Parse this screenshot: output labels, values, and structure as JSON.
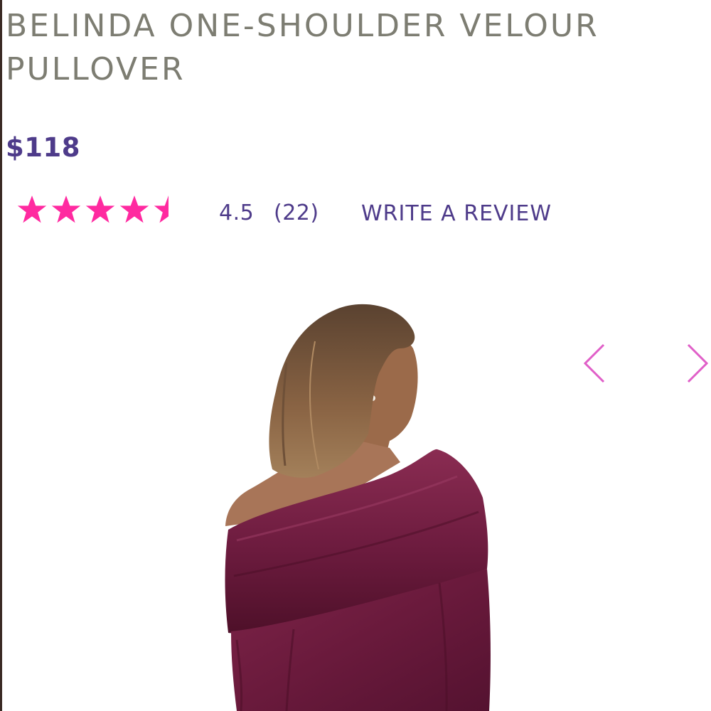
{
  "product": {
    "title": "BELINDA ONE-SHOULDER VELOUR PULLOVER",
    "price": "$118"
  },
  "rating": {
    "value": "4.5",
    "count": "(22)",
    "stars_filled": 4.5,
    "stars_total": 5,
    "star_color": "#ff2aa0"
  },
  "reviews": {
    "write_label": "WRITE A REVIEW"
  },
  "gallery": {
    "prev_icon": "chevron-left-icon",
    "next_icon": "chevron-right-icon",
    "arrow_color": "#e05fc8"
  },
  "colors": {
    "title": "#7d7d72",
    "accent": "#4e3b8a",
    "garment": "#6e1a3e"
  }
}
